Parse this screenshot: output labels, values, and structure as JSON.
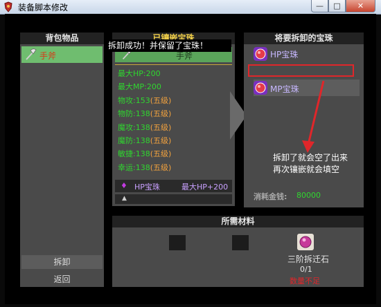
{
  "window": {
    "title": "装备脚本修改",
    "min_label": "—",
    "max_label": "□",
    "close_label": "✕"
  },
  "left_panel": {
    "header": "背包物品",
    "items": [
      {
        "label": "手斧"
      }
    ]
  },
  "middle_panel": {
    "header": "已镶嵌宝珠",
    "notice": "拆卸成功！并保留了宝珠！",
    "weapon_name": "手斧",
    "stats": [
      {
        "name": "最大HP:",
        "value": "200",
        "grade": ""
      },
      {
        "name": "最大MP:",
        "value": "200",
        "grade": ""
      },
      {
        "name": "物攻:",
        "value": "153",
        "grade": "(五级)"
      },
      {
        "name": "物防:",
        "value": "138",
        "grade": "(五级)"
      },
      {
        "name": "魔攻:",
        "value": "138",
        "grade": "(五级)"
      },
      {
        "name": "魔防:",
        "value": "138",
        "grade": "(五级)"
      },
      {
        "name": "敏捷:",
        "value": "138",
        "grade": "(五级)"
      },
      {
        "name": "幸运:",
        "value": "138",
        "grade": "(五级)"
      }
    ],
    "gem_line": {
      "name": "HP宝珠",
      "effect": "最大HP+200"
    }
  },
  "right_panel": {
    "header": "将要拆卸的宝珠",
    "gems": [
      {
        "label": "HP宝珠"
      },
      {
        "label": "MP宝珠"
      }
    ],
    "annotation_line1": "拆卸了就会空了出来",
    "annotation_line2": "再次镶嵌就会填空",
    "cost_label": "消耗金钱:",
    "cost_value": "80000"
  },
  "materials_panel": {
    "header": "所需材料",
    "material_name": "三阶拆迁石",
    "material_count": "0/1",
    "material_status": "数量不足"
  },
  "actions": {
    "dismantle_label": "拆卸",
    "back_label": "返回"
  },
  "colors": {
    "panel_bg": "#4a4a4a",
    "header_bg": "#222222",
    "stat_green": "#2fd72f",
    "grade_orange": "#f2a23e",
    "highlight_green": "#6fbd6f",
    "annotation_red": "#e0262a",
    "gem_purple": "#7a2fbf"
  }
}
